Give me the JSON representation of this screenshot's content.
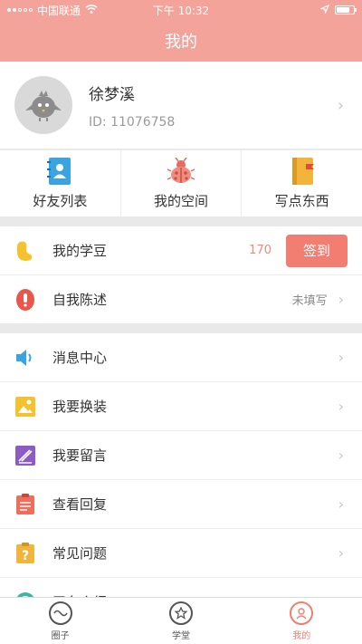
{
  "status_bar": {
    "carrier": "中国联通",
    "time": "下午 10:32"
  },
  "nav": {
    "title": "我的"
  },
  "profile": {
    "name": "徐梦溪",
    "id_text": "ID: 11076758"
  },
  "quick_actions": [
    {
      "label": "好友列表",
      "icon": "contacts-book-icon"
    },
    {
      "label": "我的空间",
      "icon": "ladybug-icon"
    },
    {
      "label": "写点东西",
      "icon": "notebook-icon"
    }
  ],
  "points": {
    "label": "我的学豆",
    "count": "170",
    "button": "签到"
  },
  "self_intro": {
    "label": "自我陈述",
    "status": "未填写"
  },
  "menu": [
    {
      "label": "消息中心",
      "icon": "speaker-icon"
    },
    {
      "label": "我要换装",
      "icon": "picture-icon"
    },
    {
      "label": "我要留言",
      "icon": "message-pen-icon"
    },
    {
      "label": "查看回复",
      "icon": "clipboard-icon"
    },
    {
      "label": "常见问题",
      "icon": "question-icon"
    },
    {
      "label": "平台介绍",
      "icon": "info-icon"
    }
  ],
  "tabs": [
    {
      "label": "圈子",
      "icon": "circle-wave-icon"
    },
    {
      "label": "学堂",
      "icon": "star-icon"
    },
    {
      "label": "我的",
      "icon": "user-icon",
      "active": true
    }
  ],
  "colors": {
    "header": "#f4a39a",
    "accent": "#f17e70"
  }
}
